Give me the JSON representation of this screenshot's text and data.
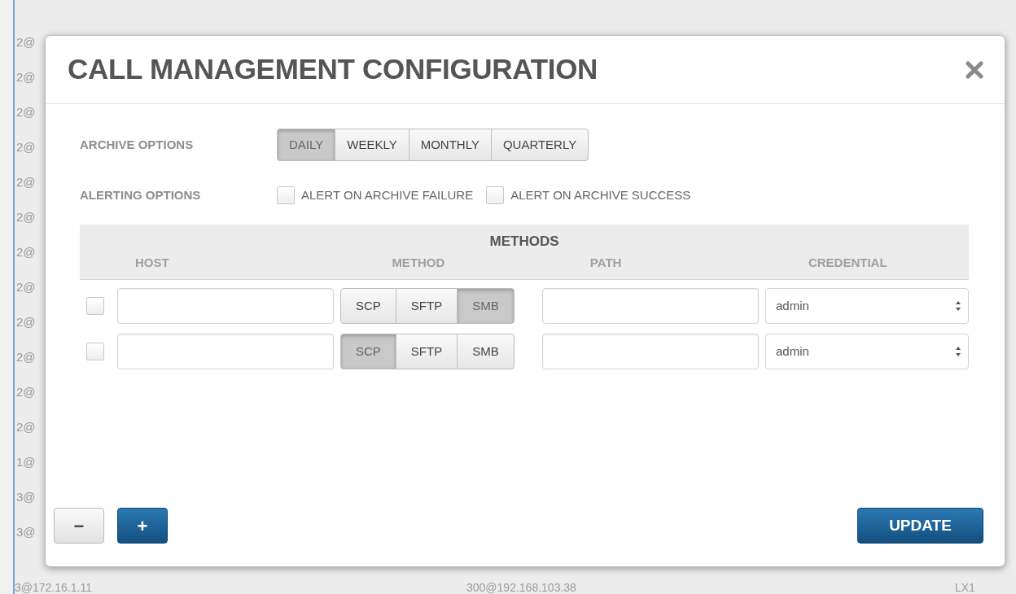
{
  "background": {
    "left_column": [
      "2@",
      "2@",
      "2@",
      "2@",
      "2@",
      "2@",
      "2@",
      "2@",
      "2@",
      "2@",
      "2@",
      "2@",
      "1@",
      "3@",
      "3@"
    ],
    "bottom_row": [
      "3@172.16.1.11",
      "300@192.168.103.38",
      "LX1"
    ]
  },
  "modal": {
    "title": "CALL MANAGEMENT CONFIGURATION",
    "archive_options": {
      "label": "ARCHIVE OPTIONS",
      "options": [
        {
          "label": "DAILY",
          "selected": true
        },
        {
          "label": "WEEKLY",
          "selected": false
        },
        {
          "label": "MONTHLY",
          "selected": false
        },
        {
          "label": "QUARTERLY",
          "selected": false
        }
      ]
    },
    "alerting_options": {
      "label": "ALERTING OPTIONS",
      "checkboxes": [
        {
          "label": "ALERT ON ARCHIVE FAILURE",
          "checked": false
        },
        {
          "label": "ALERT ON ARCHIVE SUCCESS",
          "checked": false
        }
      ]
    },
    "methods": {
      "title": "METHODS",
      "columns": [
        "HOST",
        "METHOD",
        "PATH",
        "CREDENTIAL"
      ],
      "rows": [
        {
          "checked": false,
          "methods": [
            {
              "label": "SCP",
              "selected": false
            },
            {
              "label": "SFTP",
              "selected": false
            },
            {
              "label": "SMB",
              "selected": true
            }
          ],
          "credential": "admin"
        },
        {
          "checked": false,
          "methods": [
            {
              "label": "SCP",
              "selected": true
            },
            {
              "label": "SFTP",
              "selected": false
            },
            {
              "label": "SMB",
              "selected": false
            }
          ],
          "credential": "admin"
        }
      ]
    },
    "footer": {
      "remove_button": "−",
      "add_button": "+",
      "update_button": "UPDATE"
    }
  }
}
